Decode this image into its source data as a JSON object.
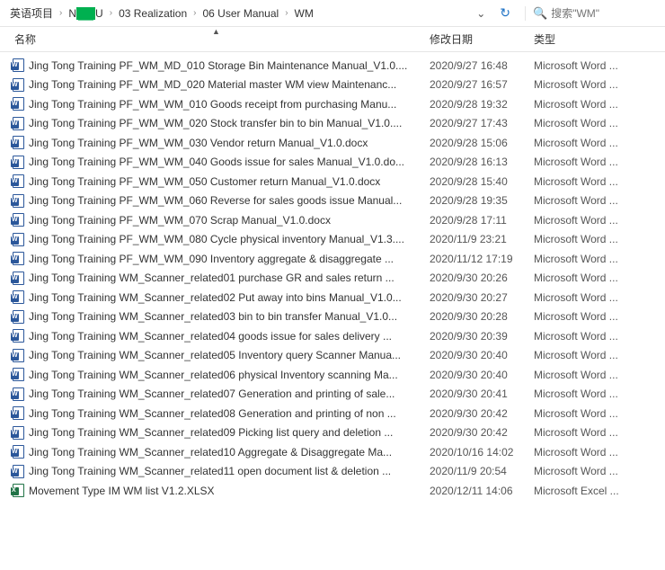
{
  "breadcrumb": {
    "items": [
      "英语项目",
      "N__U",
      "03 Realization",
      "06 User Manual",
      "WM"
    ]
  },
  "search": {
    "placeholder": "搜索\"WM\""
  },
  "columns": {
    "name": "名称",
    "date": "修改日期",
    "type": "类型"
  },
  "types": {
    "word": "Microsoft Word ...",
    "excel": "Microsoft Excel ..."
  },
  "files": [
    {
      "name": "Jing Tong Training PF_WM_MD_010 Storage Bin Maintenance Manual_V1.0....",
      "date": "2020/9/27 16:48",
      "type": "word"
    },
    {
      "name": "Jing Tong Training PF_WM_MD_020 Material master WM view Maintenanc...",
      "date": "2020/9/27 16:57",
      "type": "word"
    },
    {
      "name": "Jing Tong Training PF_WM_WM_010 Goods receipt from purchasing Manu...",
      "date": "2020/9/28 19:32",
      "type": "word"
    },
    {
      "name": "Jing Tong Training PF_WM_WM_020 Stock transfer bin to bin Manual_V1.0....",
      "date": "2020/9/27 17:43",
      "type": "word"
    },
    {
      "name": "Jing Tong Training PF_WM_WM_030 Vendor return Manual_V1.0.docx",
      "date": "2020/9/28 15:06",
      "type": "word"
    },
    {
      "name": "Jing Tong Training PF_WM_WM_040 Goods issue for sales Manual_V1.0.do...",
      "date": "2020/9/28 16:13",
      "type": "word"
    },
    {
      "name": "Jing Tong Training PF_WM_WM_050 Customer return Manual_V1.0.docx",
      "date": "2020/9/28 15:40",
      "type": "word"
    },
    {
      "name": "Jing Tong Training PF_WM_WM_060 Reverse for sales goods issue Manual...",
      "date": "2020/9/28 19:35",
      "type": "word"
    },
    {
      "name": "Jing Tong Training PF_WM_WM_070 Scrap Manual_V1.0.docx",
      "date": "2020/9/28 17:11",
      "type": "word"
    },
    {
      "name": "Jing Tong Training PF_WM_WM_080 Cycle physical inventory Manual_V1.3....",
      "date": "2020/11/9 23:21",
      "type": "word"
    },
    {
      "name": "Jing Tong Training PF_WM_WM_090 Inventory aggregate & disaggregate ...",
      "date": "2020/11/12 17:19",
      "type": "word"
    },
    {
      "name": "Jing Tong Training WM_Scanner_related01 purchase GR and sales return ...",
      "date": "2020/9/30 20:26",
      "type": "word"
    },
    {
      "name": "Jing Tong Training WM_Scanner_related02 Put away into bins Manual_V1.0...",
      "date": "2020/9/30 20:27",
      "type": "word"
    },
    {
      "name": "Jing Tong Training WM_Scanner_related03 bin to bin transfer Manual_V1.0...",
      "date": "2020/9/30 20:28",
      "type": "word"
    },
    {
      "name": "Jing Tong Training WM_Scanner_related04 goods issue for sales delivery ...",
      "date": "2020/9/30 20:39",
      "type": "word"
    },
    {
      "name": "Jing Tong Training WM_Scanner_related05 Inventory query Scanner Manua...",
      "date": "2020/9/30 20:40",
      "type": "word"
    },
    {
      "name": "Jing Tong Training WM_Scanner_related06 physical Inventory scanning Ma...",
      "date": "2020/9/30 20:40",
      "type": "word"
    },
    {
      "name": "Jing Tong Training WM_Scanner_related07 Generation and printing of sale...",
      "date": "2020/9/30 20:41",
      "type": "word"
    },
    {
      "name": "Jing Tong Training WM_Scanner_related08 Generation and printing of non ...",
      "date": "2020/9/30 20:42",
      "type": "word"
    },
    {
      "name": "Jing Tong Training WM_Scanner_related09 Picking list query and deletion ...",
      "date": "2020/9/30 20:42",
      "type": "word"
    },
    {
      "name": "Jing Tong Training WM_Scanner_related10 Aggregate & Disaggregate Ma...",
      "date": "2020/10/16 14:02",
      "type": "word"
    },
    {
      "name": "Jing Tong Training WM_Scanner_related11 open document list & deletion ...",
      "date": "2020/11/9 20:54",
      "type": "word"
    },
    {
      "name": "Movement Type IM WM list V1.2.XLSX",
      "date": "2020/12/11 14:06",
      "type": "excel"
    }
  ]
}
